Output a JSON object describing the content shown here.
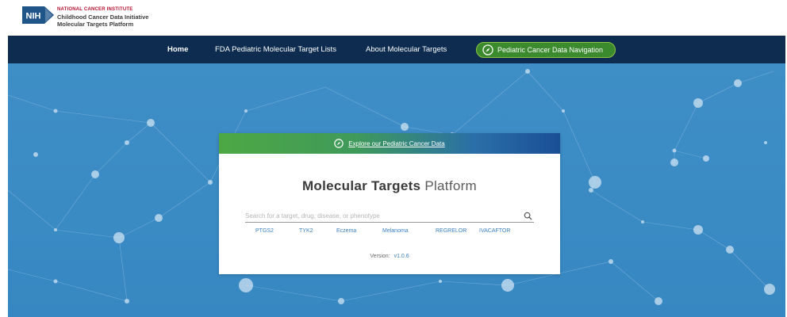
{
  "header": {
    "logo_mark": "NIH",
    "org": "NATIONAL CANCER INSTITUTE",
    "line1": "Childhood Cancer Data Initiative",
    "line2": "Molecular Targets Platform"
  },
  "nav": {
    "home": "Home",
    "fda": "FDA Pediatric Molecular Target Lists",
    "about": "About Molecular Targets",
    "pill": "Pediatric Cancer Data Navigation"
  },
  "card": {
    "banner_link": "Explore our Pediatric Cancer Data",
    "title_bold": "Molecular Targets",
    "title_light": "Platform",
    "search_placeholder": "Search for a target, drug, disease, or phenotype",
    "suggestions": [
      "PTGS2",
      "TYK2",
      "Eczema",
      "Melanoma",
      "REGRELOR",
      "IVACAFTOR"
    ],
    "version_label": "Version:",
    "version_value": "v1.0.6"
  },
  "icons": {
    "search": "search-icon",
    "compass": "compass-icon"
  },
  "colors": {
    "navbar": "#0d2c4f",
    "hero": "#3a8ac4",
    "pill_border": "#8ec63f",
    "link": "#3a7fc0",
    "nih_red": "#b5122d"
  }
}
